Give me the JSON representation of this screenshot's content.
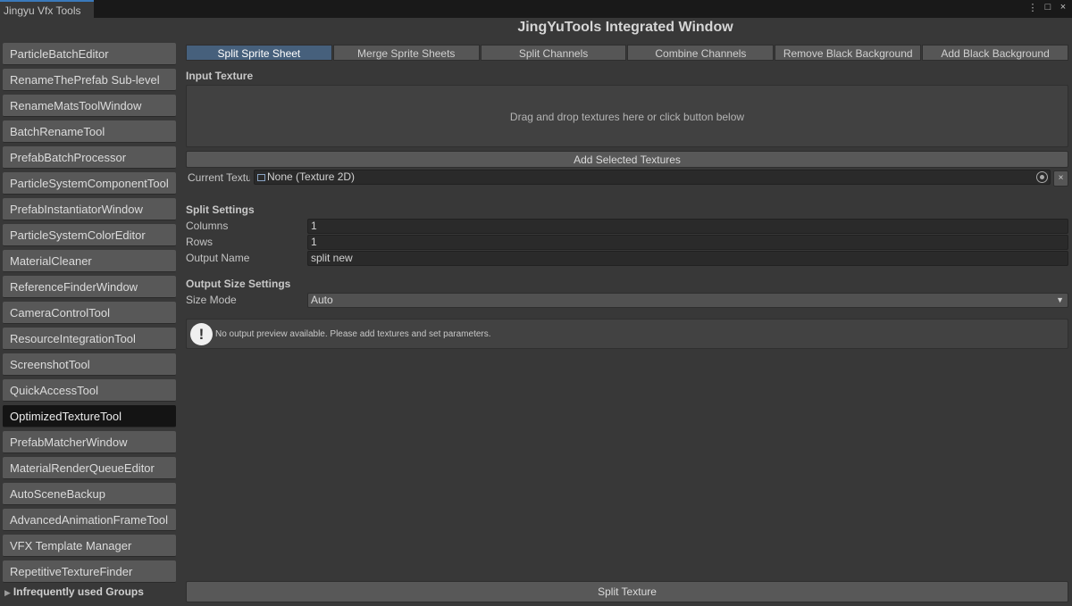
{
  "window": {
    "tab_title": "Jingyu Vfx Tools",
    "title": "JingYuTools Integrated Window",
    "controls": {
      "menu": "⋮",
      "maximize": "□",
      "close": "×"
    }
  },
  "sidebar": {
    "items": [
      {
        "label": "ParticleBatchEditor",
        "active": false
      },
      {
        "label": "RenameThePrefab Sub-level",
        "active": false
      },
      {
        "label": "RenameMatsToolWindow",
        "active": false
      },
      {
        "label": "BatchRenameTool",
        "active": false
      },
      {
        "label": "PrefabBatchProcessor",
        "active": false
      },
      {
        "label": "ParticleSystemComponentTool",
        "active": false
      },
      {
        "label": "PrefabInstantiatorWindow",
        "active": false
      },
      {
        "label": "ParticleSystemColorEditor",
        "active": false
      },
      {
        "label": "MaterialCleaner",
        "active": false
      },
      {
        "label": "ReferenceFinderWindow",
        "active": false
      },
      {
        "label": "CameraControlTool",
        "active": false
      },
      {
        "label": "ResourceIntegrationTool",
        "active": false
      },
      {
        "label": "ScreenshotTool",
        "active": false
      },
      {
        "label": "QuickAccessTool",
        "active": false
      },
      {
        "label": "OptimizedTextureTool",
        "active": true
      },
      {
        "label": "PrefabMatcherWindow",
        "active": false
      },
      {
        "label": "MaterialRenderQueueEditor",
        "active": false
      },
      {
        "label": "AutoSceneBackup",
        "active": false
      },
      {
        "label": "AdvancedAnimationFrameTool",
        "active": false
      },
      {
        "label": "VFX Template Manager",
        "active": false
      },
      {
        "label": "RepetitiveTextureFinder",
        "active": false
      }
    ],
    "group_fold": "Infrequently used Groups"
  },
  "toolbar": {
    "tabs": [
      {
        "label": "Split Sprite Sheet",
        "active": true
      },
      {
        "label": "Merge Sprite Sheets",
        "active": false
      },
      {
        "label": "Split Channels",
        "active": false
      },
      {
        "label": "Combine Channels",
        "active": false
      },
      {
        "label": "Remove Black Background",
        "active": false
      },
      {
        "label": "Add Black Background",
        "active": false
      }
    ]
  },
  "input": {
    "section_title": "Input Texture",
    "dropzone_text": "Drag and drop textures here or click button below",
    "add_button": "Add Selected Textures",
    "current_label": "Current Textu",
    "current_value": "None (Texture 2D)",
    "clear_button": "×"
  },
  "split_settings": {
    "section_title": "Split Settings",
    "columns_label": "Columns",
    "columns_value": "1",
    "rows_label": "Rows",
    "rows_value": "1",
    "output_name_label": "Output Name",
    "output_name_value": "split new"
  },
  "output_size": {
    "section_title": "Output Size Settings",
    "size_mode_label": "Size Mode",
    "size_mode_value": "Auto"
  },
  "help": {
    "icon": "!",
    "message": "No output preview available. Please add textures and set parameters."
  },
  "action_button": "Split Texture",
  "colors": {
    "active_tab": "#46607c",
    "active_sidebar": "#141414",
    "background": "#383838"
  }
}
